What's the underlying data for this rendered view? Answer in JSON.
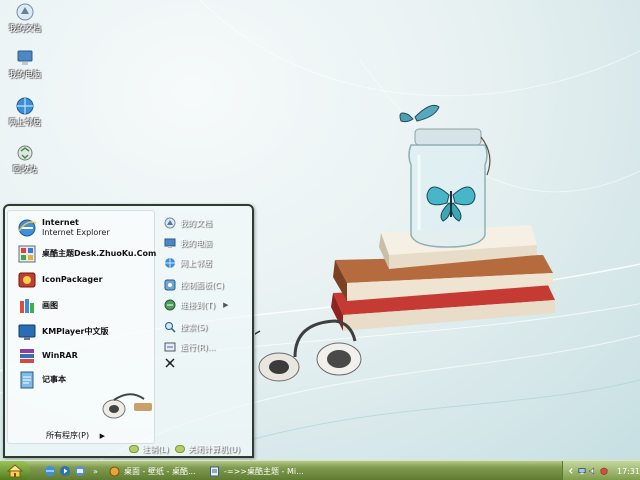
{
  "desktop": {
    "icons": [
      {
        "label": "我的文档",
        "icon": "my-documents-icon"
      },
      {
        "label": "我的电脑",
        "icon": "my-computer-icon"
      },
      {
        "label": "网上邻居",
        "icon": "network-places-icon"
      },
      {
        "label": "回收站",
        "icon": "recycle-bin-icon"
      }
    ]
  },
  "start_menu": {
    "pinned": [
      {
        "title": "Internet",
        "subtitle": "Internet Explorer",
        "icon": "internet-explorer-icon"
      },
      {
        "title": "桌酷主题Desk.ZhuoKu.Com",
        "icon": "zhuoku-theme-icon"
      },
      {
        "title": "IconPackager",
        "icon": "iconpackager-icon"
      },
      {
        "title": "画图",
        "icon": "paint-icon"
      },
      {
        "title": "KMPlayer中文版",
        "icon": "kmplayer-icon"
      },
      {
        "title": "WinRAR",
        "icon": "winrar-icon"
      },
      {
        "title": "记事本",
        "icon": "notepad-icon"
      }
    ],
    "all_programs": "所有程序(P)",
    "places": [
      {
        "label": "我的文档",
        "icon": "my-documents-icon",
        "has_submenu": false
      },
      {
        "label": "我的电脑",
        "icon": "my-computer-icon",
        "has_submenu": false
      },
      {
        "label": "网上邻居",
        "icon": "network-places-icon",
        "has_submenu": false
      },
      {
        "label": "控制面板(C)",
        "icon": "control-panel-icon",
        "has_submenu": false
      },
      {
        "label": "连接到(T)",
        "icon": "connect-to-icon",
        "has_submenu": true
      },
      {
        "label": "搜索(S)",
        "icon": "search-icon",
        "has_submenu": false
      },
      {
        "label": "运行(R)...",
        "icon": "run-icon",
        "has_submenu": false
      },
      {
        "label": "",
        "icon": "pin-icon",
        "has_submenu": false
      }
    ],
    "footer": {
      "logoff": "注销(L)",
      "shutdown": "关闭计算机(U)"
    }
  },
  "taskbar": {
    "quick_launch": [
      "internet-explorer-icon",
      "media-player-icon",
      "show-desktop-icon"
    ],
    "quick_launch_more": "»",
    "tasks": [
      {
        "label": "桌面 - 壁纸 - 桌酷...",
        "icon": "folder-icon"
      },
      {
        "label": "-=>>桌酷主题 - Mi...",
        "icon": "document-icon"
      }
    ],
    "tray_icons": [
      "tray-arrow-icon",
      "network-tray-icon",
      "speaker-tray-icon",
      "security-tray-icon"
    ],
    "clock": "17:31"
  },
  "colors": {
    "taskbar": "#6f8c3e",
    "start_menu_border": "#2f3b2f"
  }
}
